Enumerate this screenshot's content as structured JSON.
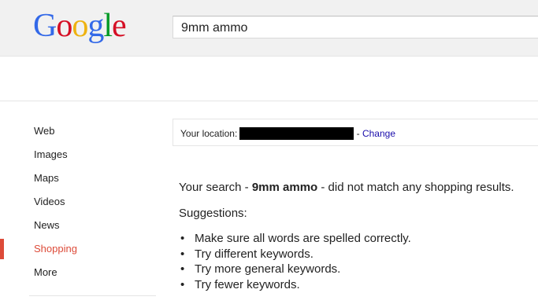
{
  "header": {
    "logo_letters": [
      {
        "char": "G",
        "color": "#3369e8"
      },
      {
        "char": "o",
        "color": "#d50f25"
      },
      {
        "char": "o",
        "color": "#eeb211"
      },
      {
        "char": "g",
        "color": "#3369e8"
      },
      {
        "char": "l",
        "color": "#009925"
      },
      {
        "char": "e",
        "color": "#d50f25"
      }
    ],
    "search_value": "9mm ammo"
  },
  "sidebar": {
    "items": [
      {
        "label": "Web"
      },
      {
        "label": "Images"
      },
      {
        "label": "Maps"
      },
      {
        "label": "Videos"
      },
      {
        "label": "News"
      },
      {
        "label": "Shopping",
        "active": true
      },
      {
        "label": "More"
      }
    ],
    "active_color": "#dd4b39"
  },
  "location": {
    "label": "Your location:",
    "separator": "-",
    "change_label": "Change"
  },
  "results": {
    "message_prefix": "Your search -",
    "query": "9mm ammo",
    "message_suffix": "- did not match any shopping results.",
    "suggestions_title": "Suggestions:",
    "suggestions": [
      "Make sure all words are spelled correctly.",
      "Try different keywords.",
      "Try more general keywords.",
      "Try fewer keywords."
    ]
  }
}
